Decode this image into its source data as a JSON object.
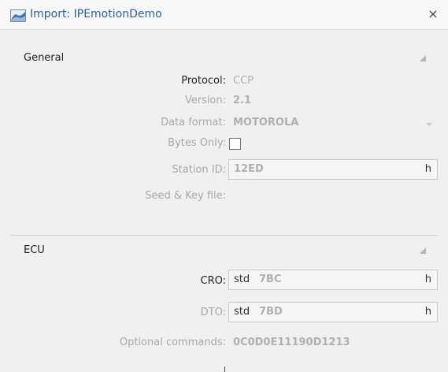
{
  "window": {
    "title": "Import: IPEmotionDemo",
    "close_glyph": "×",
    "icon": "chart-area-icon"
  },
  "general": {
    "header": "General",
    "protocol_label": "Protocol:",
    "protocol_value": "CCP",
    "version_label": "Version:",
    "version_value": "2.1",
    "data_format_label": "Data format:",
    "data_format_value": "MOTOROLA",
    "bytes_only_label": "Bytes Only:",
    "bytes_only_checked": false,
    "station_id_label": "Station ID:",
    "station_id_value": "12ED",
    "station_id_suffix": "h",
    "seed_key_label": "Seed & Key file:"
  },
  "ecu": {
    "header": "ECU",
    "cro_label": "CRO:",
    "cro_prefix": "std",
    "cro_value": "7BC",
    "cro_suffix": "h",
    "dto_label": "DTO:",
    "dto_prefix": "std",
    "dto_value": "7BD",
    "dto_suffix": "h",
    "optional_commands_label": "Optional commands:",
    "optional_commands_value": "0C0D0E11190D1213"
  },
  "colors": {
    "title": "#2a5f9e",
    "disabled_text": "#a8a8a8",
    "background": "#f0f0f0"
  }
}
